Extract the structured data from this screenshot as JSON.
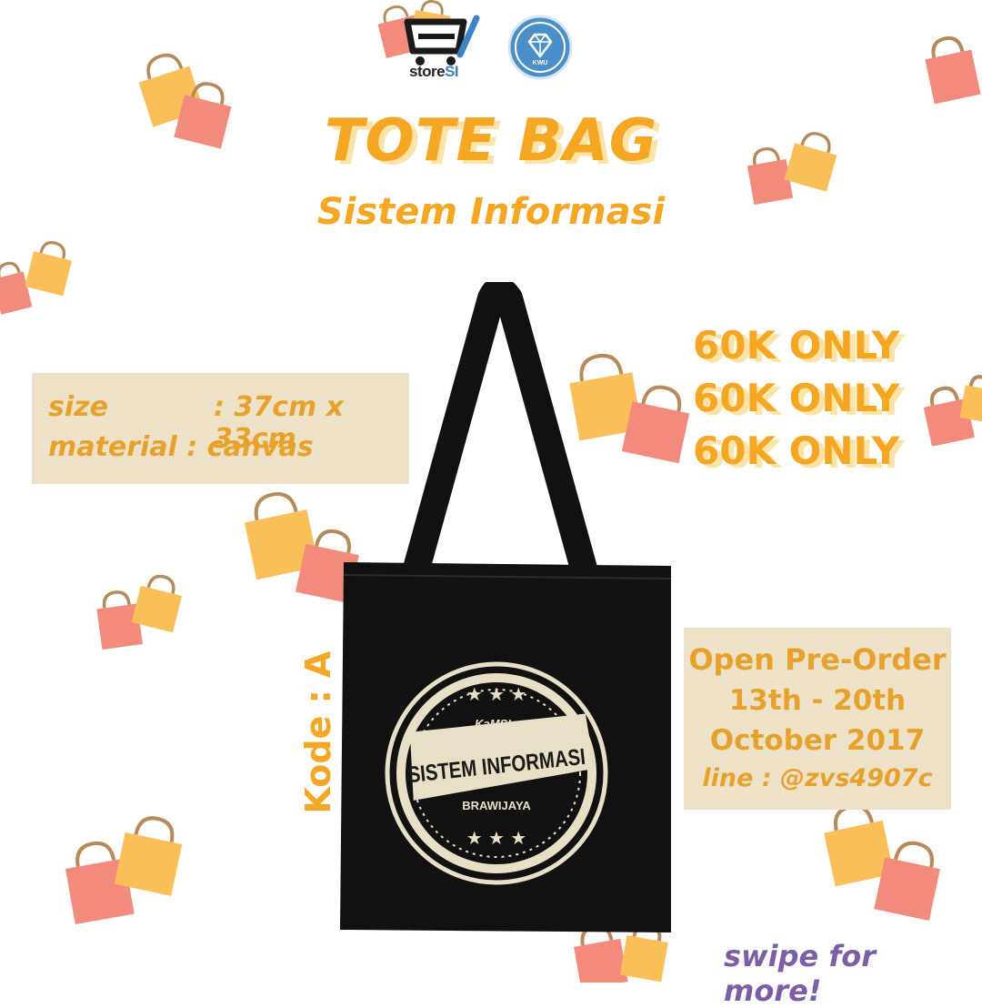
{
  "logos": {
    "store_prefix": "store",
    "store_suffix": "SI",
    "kwu_label": "KWU"
  },
  "title": "TOTE BAG",
  "subtitle": "Sistem Informasi",
  "specs": {
    "size_label": "size",
    "size_value": ": 37cm x 33cm",
    "material_line": "material : canvas"
  },
  "price_lines": [
    "60K ONLY",
    "60K ONLY",
    "60K ONLY"
  ],
  "preorder": {
    "heading": "Open Pre-Order",
    "dates": "13th - 20th",
    "month_year": "October 2017",
    "contact": "line : @zvs4907c"
  },
  "kode_label": "Kode : A",
  "swipe_text": "swipe for more!",
  "bag_print": {
    "brand_small": "KaMSI",
    "main_text": "SISTEM INFORMASI",
    "sub_text": "BRAWIJAYA"
  },
  "colors": {
    "accent_orange": "#f5a623",
    "box_beige": "#ede2c8",
    "swipe_purple": "#7b5ea7",
    "bag_black": "#111111",
    "print_cream": "#e8e0c6",
    "deco_yellow": "#fbbf5a",
    "deco_pink": "#f28b7c"
  }
}
